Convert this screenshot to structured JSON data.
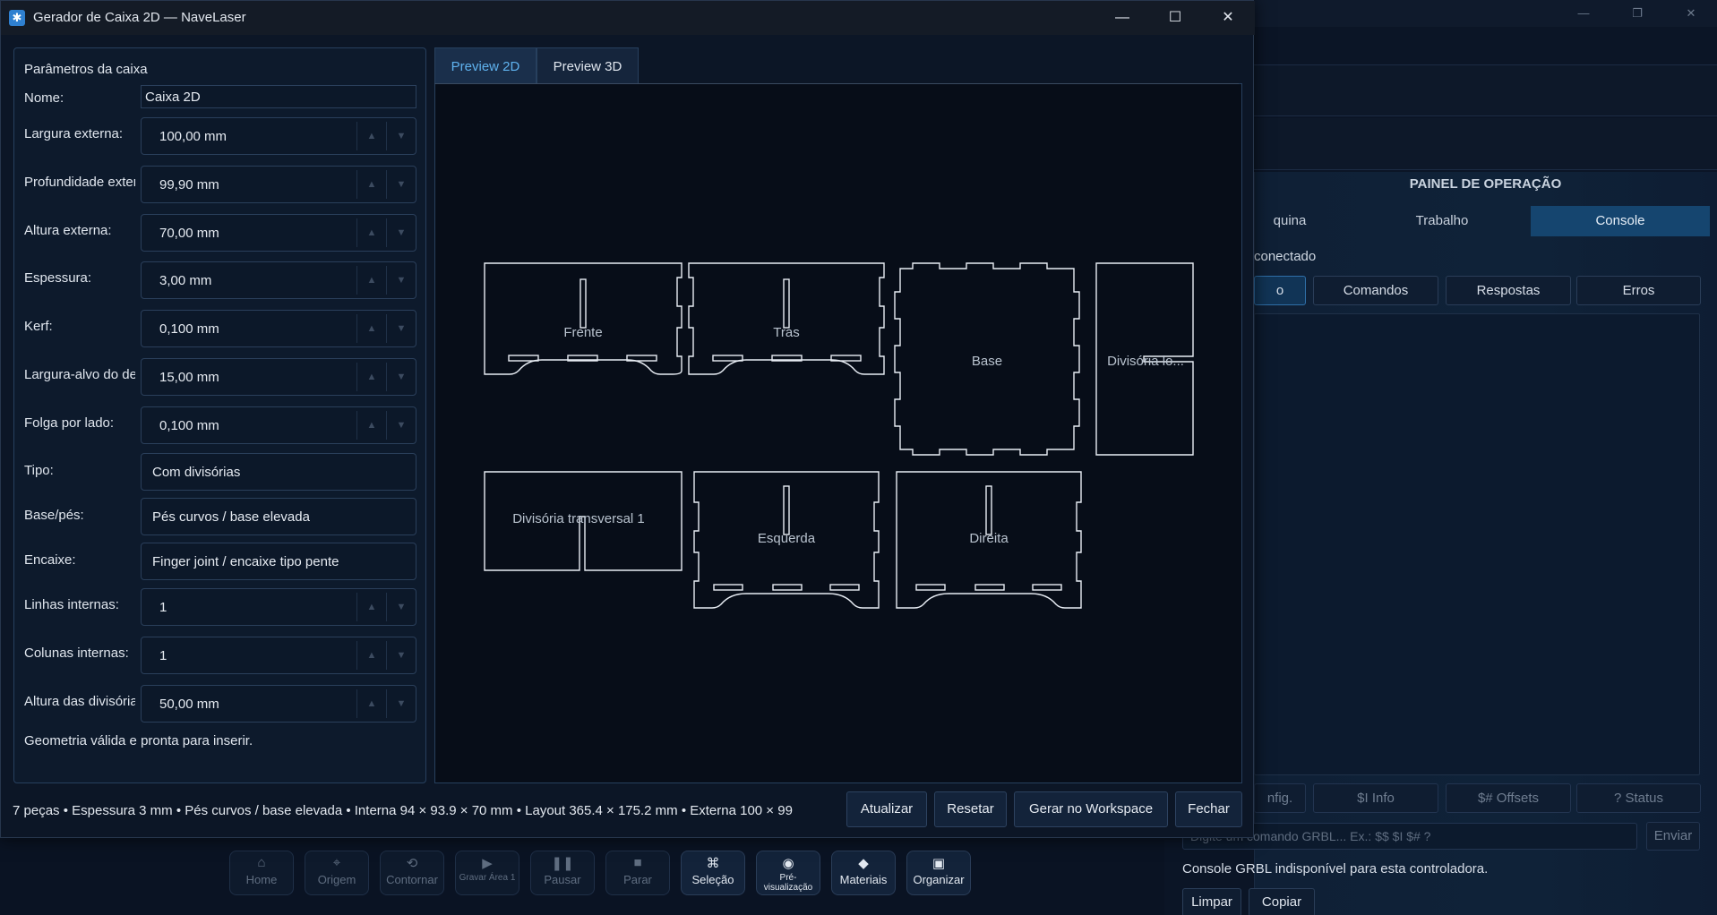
{
  "dialog": {
    "title": "Gerador de Caixa 2D — NaveLaser",
    "minimize_glyph": "—",
    "maximize_glyph": "☐",
    "close_glyph": "✕"
  },
  "params": {
    "title": "Parâmetros da caixa",
    "name_label": "Nome:",
    "name_value": "Caixa 2D",
    "fields": [
      {
        "label": "Largura externa:",
        "value": "100,00 mm"
      },
      {
        "label": "Profundidade externa:",
        "value": "99,90 mm"
      },
      {
        "label": "Altura externa:",
        "value": "70,00 mm"
      },
      {
        "label": "Espessura:",
        "value": "3,00 mm"
      },
      {
        "label": "Kerf:",
        "value": "0,100 mm"
      },
      {
        "label": "Largura-alvo do dente:",
        "value": "15,00 mm"
      },
      {
        "label": "Folga por lado:",
        "value": "0,100 mm"
      }
    ],
    "combos": [
      {
        "label": "Tipo:",
        "value": "Com divisórias"
      },
      {
        "label": "Base/pés:",
        "value": "Pés curvos / base elevada"
      },
      {
        "label": "Encaixe:",
        "value": "Finger joint / encaixe tipo pente"
      }
    ],
    "fields2": [
      {
        "label": "Linhas internas:",
        "value": "1"
      },
      {
        "label": "Colunas internas:",
        "value": "1"
      },
      {
        "label": "Altura das divisórias:",
        "value": "50,00 mm"
      }
    ],
    "geometry_message": "Geometria válida e pronta para inserir."
  },
  "preview": {
    "tabs": [
      "Preview 2D",
      "Preview 3D"
    ],
    "pieces": {
      "frente": "Frente",
      "tras": "Tras",
      "base": "Base",
      "divisoria_long": "Divisória lo...",
      "divisoria_trans": "Divisória transversal 1",
      "esquerda": "Esquerda",
      "direita": "Direita"
    }
  },
  "footer": {
    "summary": "7 peças • Espessura 3 mm • Pés curvos / base elevada • Interna 94 × 93.9 × 70 mm • Layout 365.4 × 175.2 mm • Externa 100 × 99",
    "update": "Atualizar",
    "reset": "Resetar",
    "generate": "Gerar no Workspace",
    "close": "Fechar"
  },
  "background": {
    "panel_title": "PAINEL DE OPERAÇÃO",
    "tabs": [
      "quina",
      "Trabalho",
      "Console"
    ],
    "status": "conectado",
    "filters": [
      "o",
      "Comandos",
      "Respostas",
      "Erros"
    ],
    "quick_cmds": [
      "nfig.",
      "$I Info",
      "$# Offsets",
      "? Status"
    ],
    "cmd_placeholder": "Digite um comando GRBL...   Ex.: $$   $I   $#   ?",
    "send": "Enviar",
    "grbl_message": "Console GRBL indisponível para esta controladora.",
    "clear": "Limpar",
    "copy": "Copiar",
    "toolbar": [
      {
        "label": "Home",
        "icon": "⌂"
      },
      {
        "label": "Origem",
        "icon": "⌖"
      },
      {
        "label": "Contornar",
        "icon": "⟲"
      },
      {
        "label": "Gravar Área 1",
        "icon": "▶"
      },
      {
        "label": "Pausar",
        "icon": "❚❚"
      },
      {
        "label": "Parar",
        "icon": "■"
      },
      {
        "label": "Seleção",
        "icon": "⌘"
      },
      {
        "label": "Pré-visualização",
        "icon": "◉"
      },
      {
        "label": "Materiais",
        "icon": "◆"
      },
      {
        "label": "Organizar",
        "icon": "▣"
      }
    ]
  }
}
